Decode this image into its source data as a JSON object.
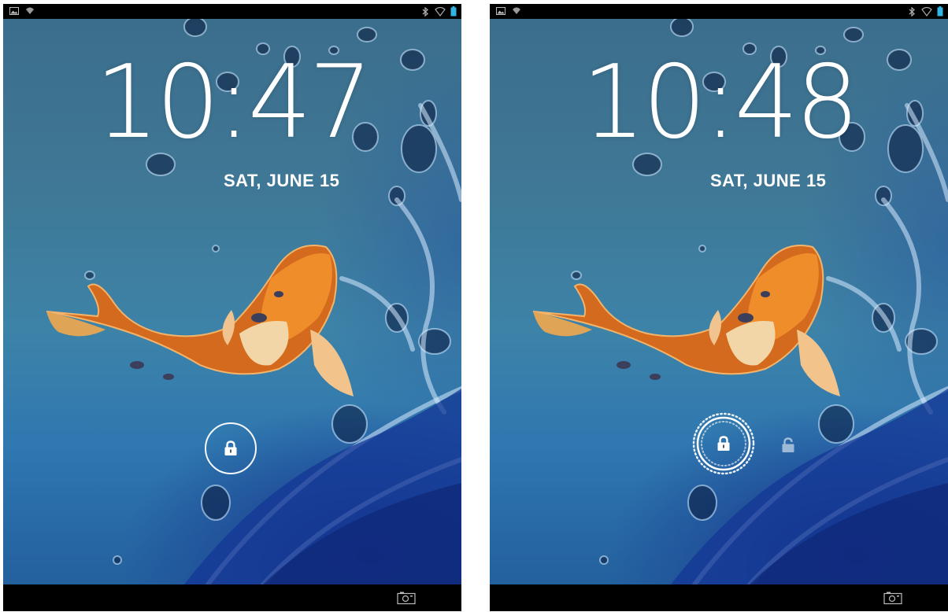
{
  "screens": [
    {
      "clock": {
        "time": "10:47"
      },
      "date": "SAT, JUNE 15",
      "lock_state": "idle"
    },
    {
      "clock": {
        "time": "10:48"
      },
      "date": "SAT, JUNE 15",
      "lock_state": "touched"
    }
  ],
  "icons": {
    "status_left": [
      "image-notification-icon",
      "wifi-signal-icon"
    ],
    "status_right": [
      "bluetooth-icon",
      "wifi-icon",
      "battery-icon"
    ],
    "lock": "lock-icon",
    "unlock": "unlock-icon",
    "camera": "camera-icon"
  },
  "colors": {
    "accent": "#33b5e5",
    "text": "#ffffff",
    "bar": "#000000"
  }
}
